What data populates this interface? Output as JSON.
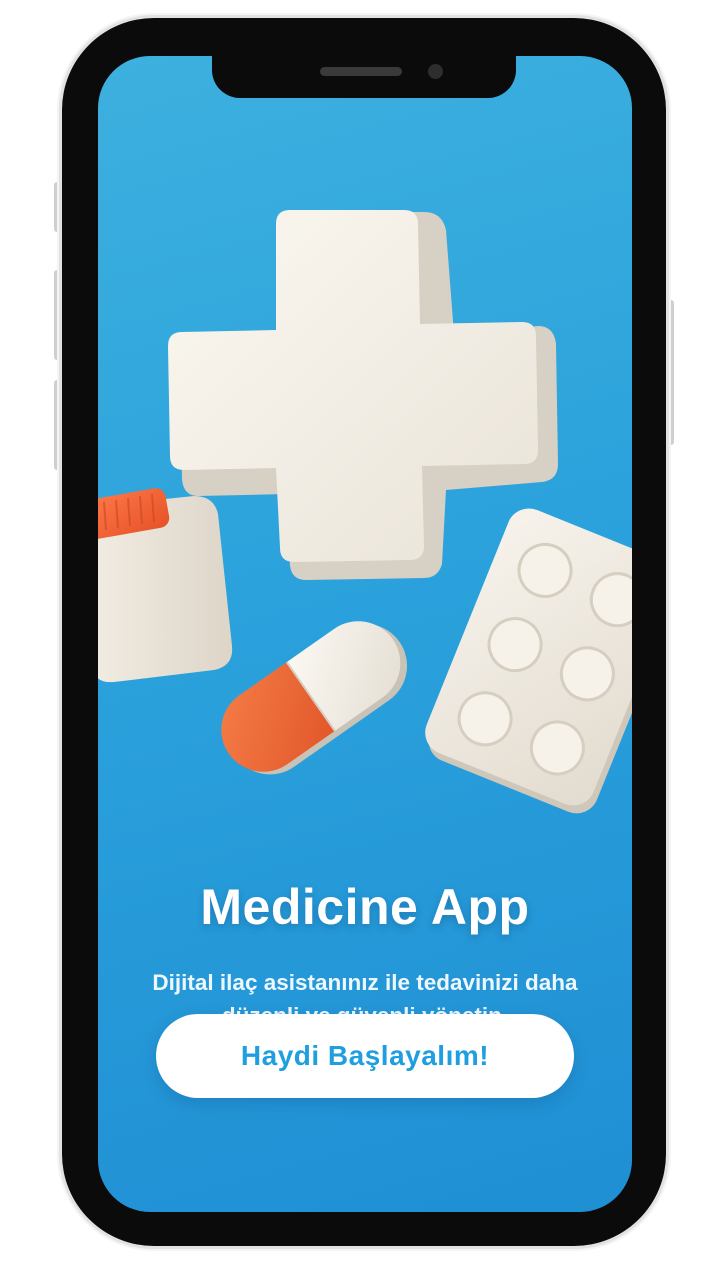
{
  "screen": {
    "title": "Medicine App",
    "subtitle": "Dijital ilaç asistanınız ile tedavinizi daha düzenli ve güvenli yönetin.",
    "cta_label": "Haydi Başlayalım!"
  },
  "theme": {
    "background_top": "#3db0de",
    "background_bottom": "#1f8fd4",
    "accent": "#1f9fe0",
    "pill_orange": "#f26a3a"
  },
  "illustration_items": [
    "medical-cross-icon",
    "pill-bottle-icon",
    "capsule-icon",
    "blister-pack-icon"
  ]
}
